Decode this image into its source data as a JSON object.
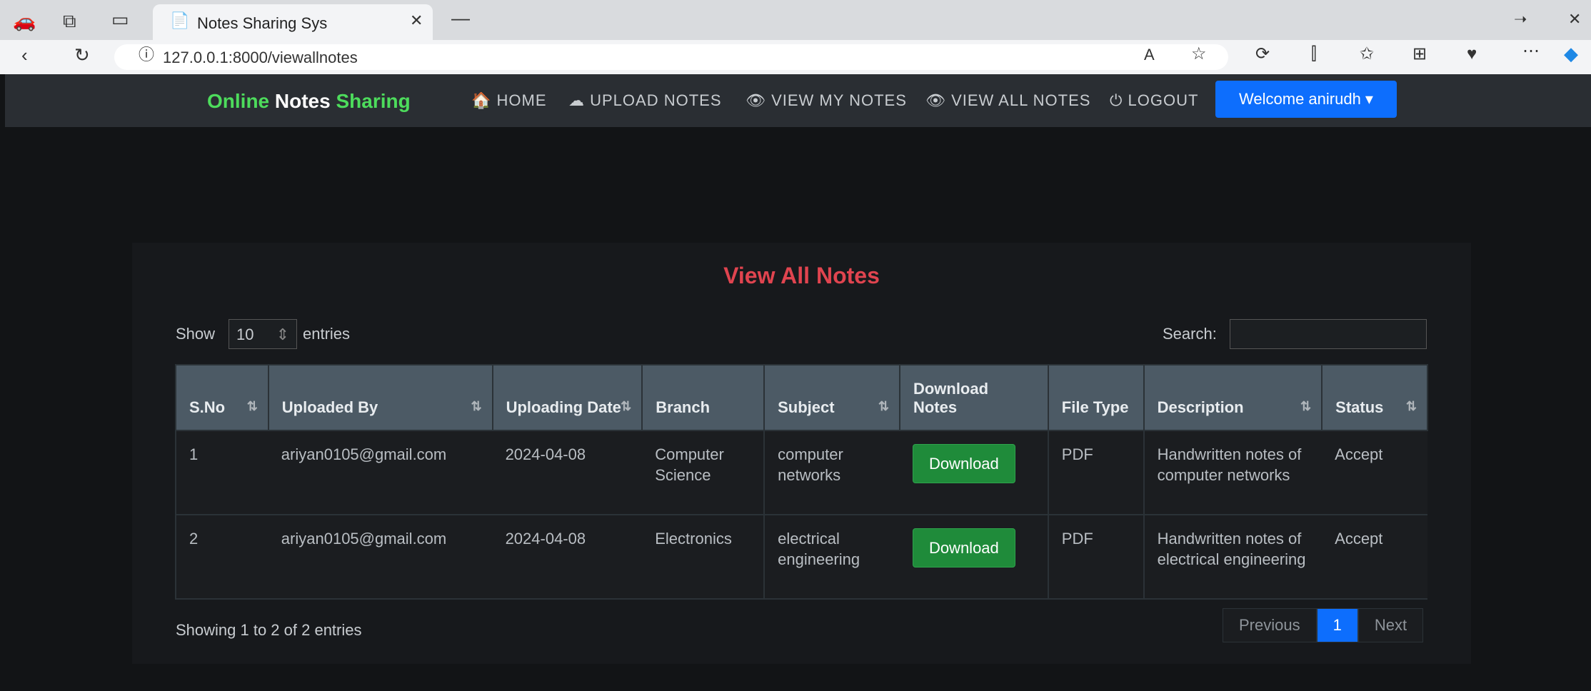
{
  "browser": {
    "tab_title": "Notes Sharing Sys",
    "url": "127.0.0.1:8000/viewallnotes",
    "menu_glyph": "⋯"
  },
  "navbar": {
    "brand_word1": "Online",
    "brand_word2": "Notes",
    "brand_word3": "Sharing",
    "home": "HOME",
    "upload": "UPLOAD NOTES",
    "view_my": "VIEW MY NOTES",
    "view_all": "VIEW ALL NOTES",
    "logout": "LOGOUT",
    "welcome": "Welcome anirudh ▾"
  },
  "page": {
    "title": "View All Notes",
    "show_label": "Show",
    "entries_value": "10",
    "entries_label": "entries",
    "search_label": "Search:",
    "footer": "Showing 1 to 2 of 2 entries",
    "pagination": [
      "Previous",
      "1",
      "Next"
    ]
  },
  "table": {
    "headers": [
      "S.No",
      "Uploaded By",
      "Uploading Date",
      "Branch",
      "Subject",
      "Download Notes",
      "File Type",
      "Description",
      "Status"
    ],
    "rows": [
      {
        "sno": "1",
        "by": "ariyan0105@gmail.com",
        "date": "2024-04-08",
        "branch": "Computer Science",
        "subject": "computer networks",
        "download": "Download",
        "type": "PDF",
        "desc": "Handwritten notes of computer networks",
        "status": "Accept"
      },
      {
        "sno": "2",
        "by": "ariyan0105@gmail.com",
        "date": "2024-04-08",
        "branch": "Electronics",
        "subject": "electrical engineering",
        "download": "Download",
        "type": "PDF",
        "desc": "Handwritten notes of electrical engineering",
        "status": "Accept"
      }
    ]
  },
  "colors": {
    "brand_green": "#4ddc5c",
    "title_red": "#e0444f",
    "primary": "#0d6efd",
    "success": "#1f8b3a"
  }
}
